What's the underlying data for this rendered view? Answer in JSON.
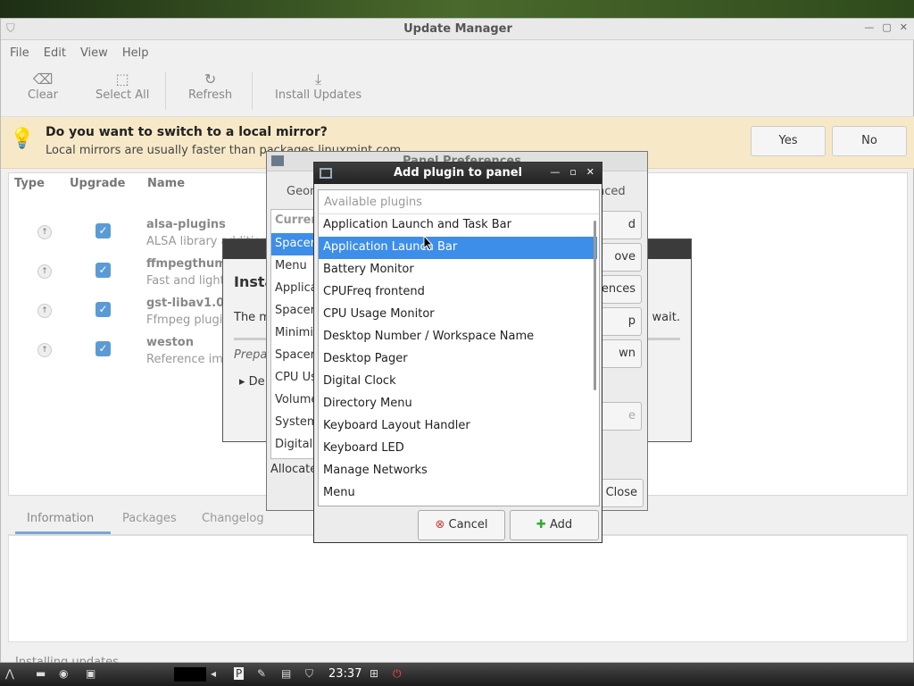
{
  "main_window": {
    "title": "Update Manager",
    "menu": [
      "File",
      "Edit",
      "View",
      "Help"
    ],
    "toolbar": {
      "clear": "Clear",
      "select_all": "Select All",
      "refresh": "Refresh",
      "install_updates": "Install Updates"
    },
    "infobar": {
      "question": "Do you want to switch to a local mirror?",
      "detail": "Local mirrors are usually faster than packages.linuxmint.com",
      "yes": "Yes",
      "no": "No"
    },
    "columns": {
      "type": "Type",
      "upgrade": "Upgrade",
      "name": "Name"
    },
    "packages": [
      {
        "name": "alsa-plugins",
        "desc": "ALSA library additional plugins"
      },
      {
        "name": "ffmpegthumbnailer",
        "desc": "Fast and lightweight video thumbnailer"
      },
      {
        "name": "gst-libav1.0",
        "desc": "Ffmpeg plugin for GStreamer"
      },
      {
        "name": "weston",
        "desc": "Reference implementation of a wayland compositor"
      }
    ],
    "tabs": [
      "Information",
      "Packages",
      "Changelog"
    ],
    "status": "Installing updates"
  },
  "install_dialog": {
    "heading": "Insta",
    "message": "The m",
    "wait": "e wait.",
    "preparing": "Prepa",
    "details": "De"
  },
  "panel_prefs": {
    "title": "Panel Preferences",
    "tabs": [
      "Geom",
      "nced"
    ],
    "list_header": "Curren",
    "items": [
      "Spacer",
      "Menu",
      "Applicat",
      "Spacer",
      "Minimiz",
      "Spacer",
      "CPU Us",
      "Volume",
      "System",
      "Digital C"
    ],
    "allocate": "Allocate",
    "buttons": [
      "d",
      "ove",
      "ences",
      "p",
      "wn"
    ],
    "hidden_btn": "e",
    "close": "Close"
  },
  "add_plugin": {
    "title": "Add plugin to panel",
    "list_header": "Available plugins",
    "plugins": [
      "Application Launch and Task Bar",
      "Application Launch Bar",
      "Battery Monitor",
      "CPUFreq frontend",
      "CPU Usage Monitor",
      "Desktop Number / Workspace Name",
      "Desktop Pager",
      "Digital Clock",
      "Directory Menu",
      "Keyboard Layout Handler",
      "Keyboard LED",
      "Manage Networks",
      "Menu"
    ],
    "selected_index": 1,
    "cancel": "Cancel",
    "add": "Add"
  },
  "taskbar": {
    "clock": "23:37"
  },
  "colors": {
    "selection": "#3d8ee8",
    "infobar": "#f7e9c8",
    "checkbox": "#5a9bd5"
  }
}
